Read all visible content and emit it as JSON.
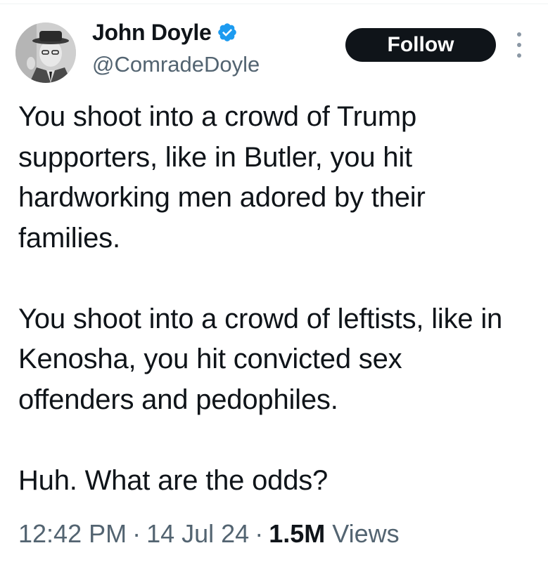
{
  "author": {
    "display_name": "John Doyle",
    "handle": "@ComradeDoyle",
    "verified": true,
    "avatar_icon": "profile-photo"
  },
  "actions": {
    "follow_label": "Follow",
    "more_icon": "more-vertical-icon"
  },
  "tweet": {
    "paragraphs": [
      "You shoot into a crowd of Trump supporters, like in Butler, you hit hardworking men adored by their families.",
      "You shoot into a crowd of leftists, like in Kenosha, you hit convicted sex offenders and pedophiles.",
      "Huh. What are the odds?"
    ]
  },
  "meta": {
    "time": "12:42 PM",
    "separator": "·",
    "date": "14 Jul 24",
    "views_count": "1.5M",
    "views_label": "Views"
  },
  "colors": {
    "text": "#0f1419",
    "secondary_text": "#536471",
    "verified_badge": "#1d9bf0",
    "follow_bg": "#0f1419",
    "follow_text": "#ffffff"
  }
}
